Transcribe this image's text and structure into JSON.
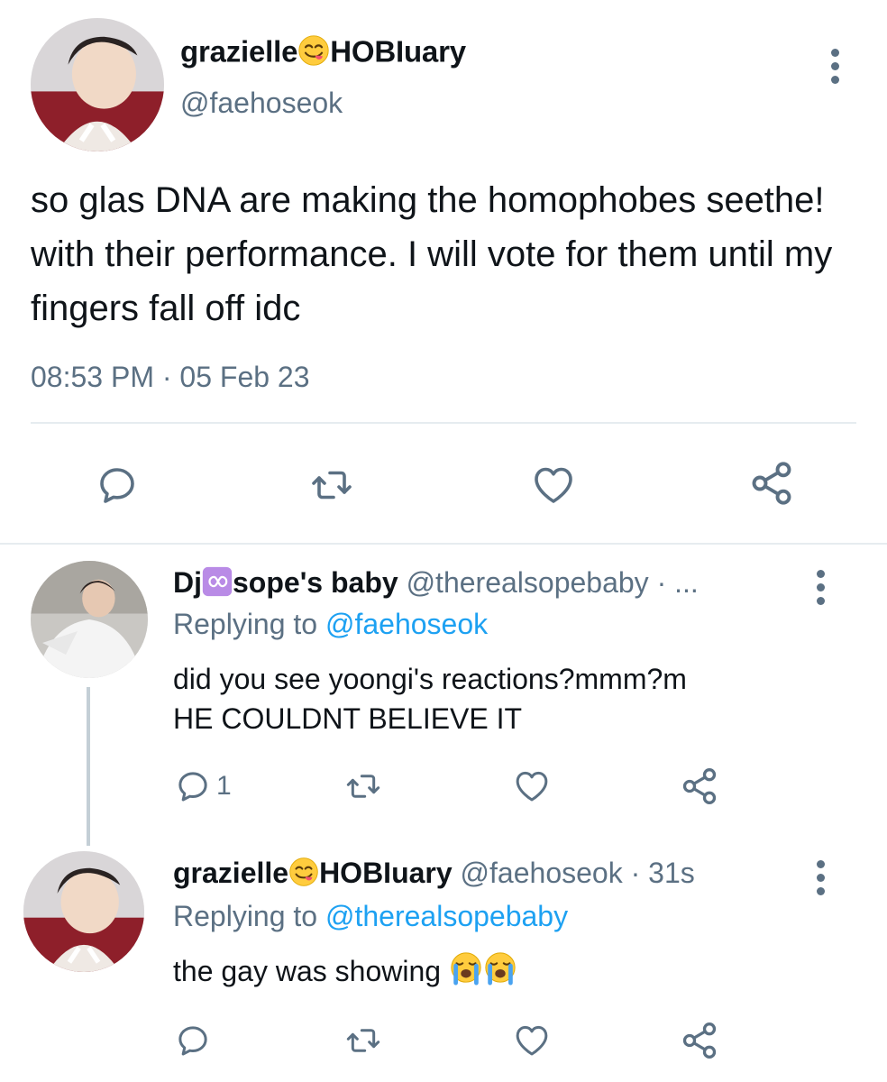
{
  "main_tweet": {
    "display_name": "grazielle",
    "name_suffix": "HOBIuary",
    "handle": "@faehoseok",
    "text": "so glas DNA are making the homophobes seethe! with their performance. I will vote for them until my fingers fall off idc",
    "timestamp": "08:53 PM · 05 Feb 23"
  },
  "replies": [
    {
      "display_name_prefix": "Dj",
      "display_name_suffix": "sope's baby",
      "handle_meta": "@therealsopebaby · ...",
      "replying_label": "Replying to",
      "replying_to": "@faehoseok",
      "text_line1": "did you see yoongi's reactions?mmm?m",
      "text_line2": "HE COULDNT BELIEVE IT",
      "reply_count": "1"
    },
    {
      "display_name_prefix": "grazielle",
      "display_name_suffix": "HOBIuary",
      "handle_meta": "@faehoseok · 31s",
      "replying_label": "Replying to",
      "replying_to": "@therealsopebaby",
      "text": "the gay was showing"
    }
  ],
  "icons": [
    "reply-icon",
    "retweet-icon",
    "like-icon",
    "share-icon",
    "more-icon",
    "yum-emoji",
    "infinity-emoji",
    "loudly-crying-emoji"
  ],
  "colors": {
    "text": "#0f1419",
    "muted": "#5b7083",
    "link": "#1da1f2",
    "divider": "#e6ecf0"
  }
}
